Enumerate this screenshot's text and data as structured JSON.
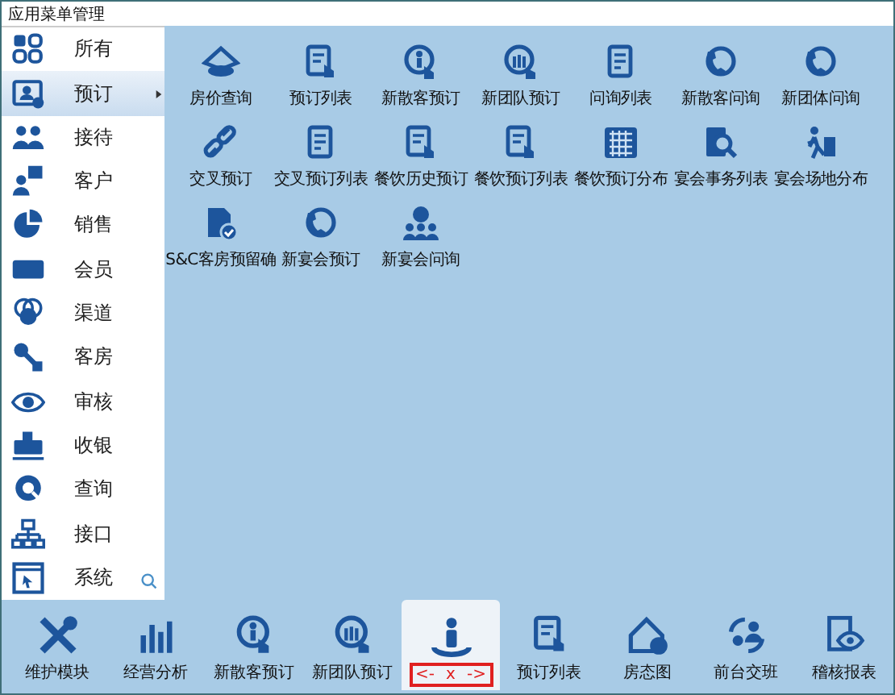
{
  "window": {
    "title": "应用菜单管理"
  },
  "sidebar": {
    "items": [
      {
        "label": "所有",
        "selected": false
      },
      {
        "label": "预订",
        "selected": true
      },
      {
        "label": "接待",
        "selected": false
      },
      {
        "label": "客户",
        "selected": false
      },
      {
        "label": "销售",
        "selected": false
      },
      {
        "label": "会员",
        "selected": false
      },
      {
        "label": "渠道",
        "selected": false
      },
      {
        "label": "客房",
        "selected": false
      },
      {
        "label": "审核",
        "selected": false
      },
      {
        "label": "收银",
        "selected": false
      },
      {
        "label": "查询",
        "selected": false
      },
      {
        "label": "接口",
        "selected": false
      },
      {
        "label": "系统",
        "selected": false
      }
    ]
  },
  "menu_grid": {
    "items": [
      {
        "label": "房价查询"
      },
      {
        "label": "预订列表"
      },
      {
        "label": "新散客预订"
      },
      {
        "label": "新团队预订"
      },
      {
        "label": "问询列表"
      },
      {
        "label": "新散客问询"
      },
      {
        "label": "新团体问询"
      },
      {
        "label": "交叉预订"
      },
      {
        "label": "交叉预订列表"
      },
      {
        "label": "餐饮历史预订"
      },
      {
        "label": "餐饮预订列表"
      },
      {
        "label": "餐饮预订分布"
      },
      {
        "label": "宴会事务列表"
      },
      {
        "label": "宴会场地分布"
      },
      {
        "label": "S&C客房预留确"
      },
      {
        "label": "新宴会预订"
      },
      {
        "label": "新宴会问询"
      }
    ]
  },
  "taskbar": {
    "items": [
      {
        "label": "维护模块",
        "selected": false
      },
      {
        "label": "经营分析",
        "selected": false
      },
      {
        "label": "新散客预订",
        "selected": false
      },
      {
        "label": "新团队预订",
        "selected": false
      },
      {
        "selected": true,
        "controls": [
          "<-",
          "x",
          "->"
        ]
      },
      {
        "label": "预订列表",
        "selected": false
      },
      {
        "label": "房态图",
        "selected": false
      },
      {
        "label": "前台交班",
        "selected": false
      },
      {
        "label": "稽核报表",
        "selected": false
      }
    ]
  }
}
